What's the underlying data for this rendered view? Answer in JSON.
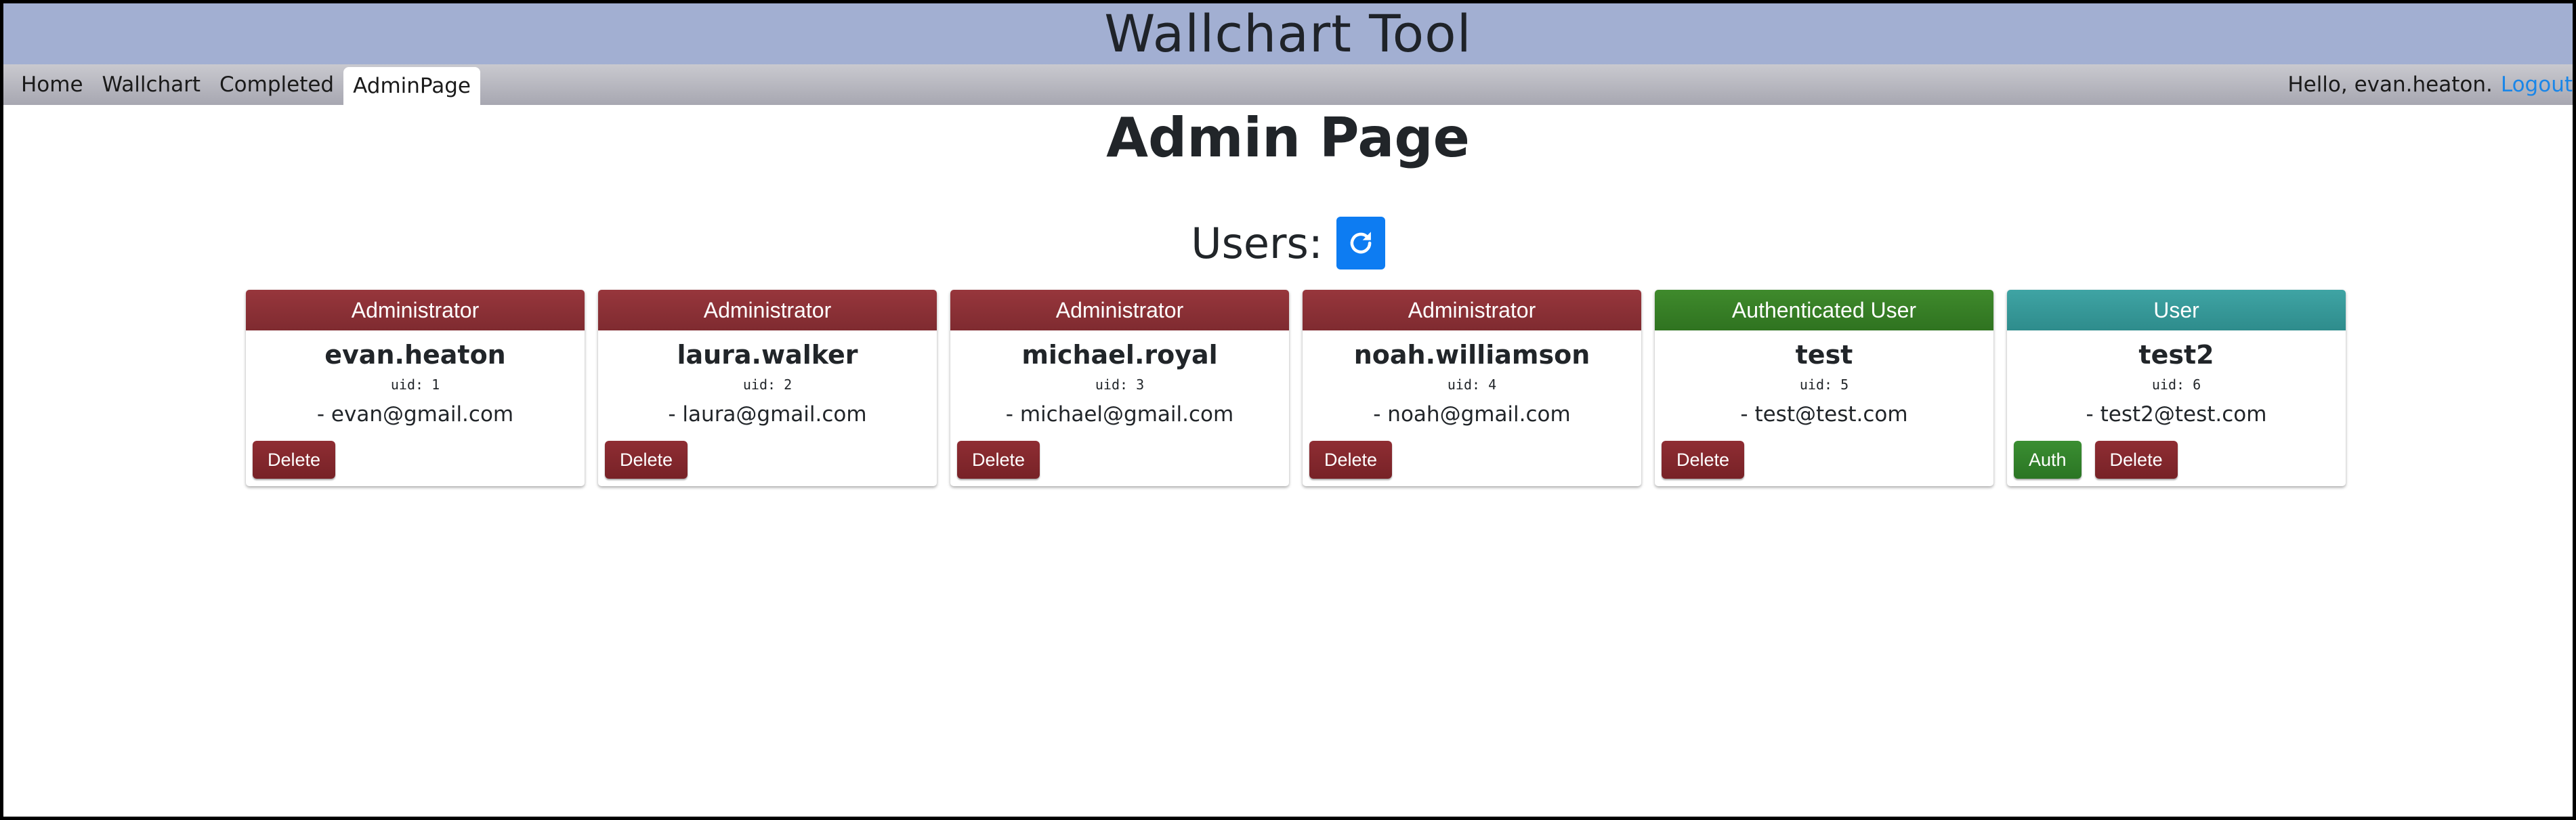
{
  "header": {
    "title": "Wallchart Tool"
  },
  "nav": {
    "tabs": [
      {
        "label": "Home"
      },
      {
        "label": "Wallchart"
      },
      {
        "label": "Completed"
      },
      {
        "label": "AdminPage",
        "active": true
      }
    ],
    "greeting": "Hello, evan.heaton.",
    "logout": "Logout"
  },
  "main": {
    "title": "Admin Page",
    "users_label": "Users:",
    "refresh_icon": "refresh-icon"
  },
  "users": [
    {
      "role": "Administrator",
      "username": "evan.heaton",
      "uid": "uid: 1",
      "email": "- evan@gmail.com",
      "delete_label": "Delete"
    },
    {
      "role": "Administrator",
      "username": "laura.walker",
      "uid": "uid: 2",
      "email": "- laura@gmail.com",
      "delete_label": "Delete"
    },
    {
      "role": "Administrator",
      "username": "michael.royal",
      "uid": "uid: 3",
      "email": "- michael@gmail.com",
      "delete_label": "Delete"
    },
    {
      "role": "Administrator",
      "username": "noah.williamson",
      "uid": "uid: 4",
      "email": "- noah@gmail.com",
      "delete_label": "Delete"
    },
    {
      "role": "Authenticated User",
      "username": "test",
      "uid": "uid: 5",
      "email": "- test@test.com",
      "delete_label": "Delete"
    },
    {
      "role": "User",
      "username": "test2",
      "uid": "uid: 6",
      "email": "- test2@test.com",
      "auth_label": "Auth",
      "delete_label": "Delete"
    }
  ],
  "colors": {
    "header_bg": "#a2afd2",
    "admin_role": "#8a3136",
    "authenticated_role": "#37802a",
    "user_role": "#379898",
    "delete_button": "#83282d",
    "auth_button": "#33822b",
    "refresh_button": "#0d7cf2",
    "logout_link": "#1a86e8"
  }
}
